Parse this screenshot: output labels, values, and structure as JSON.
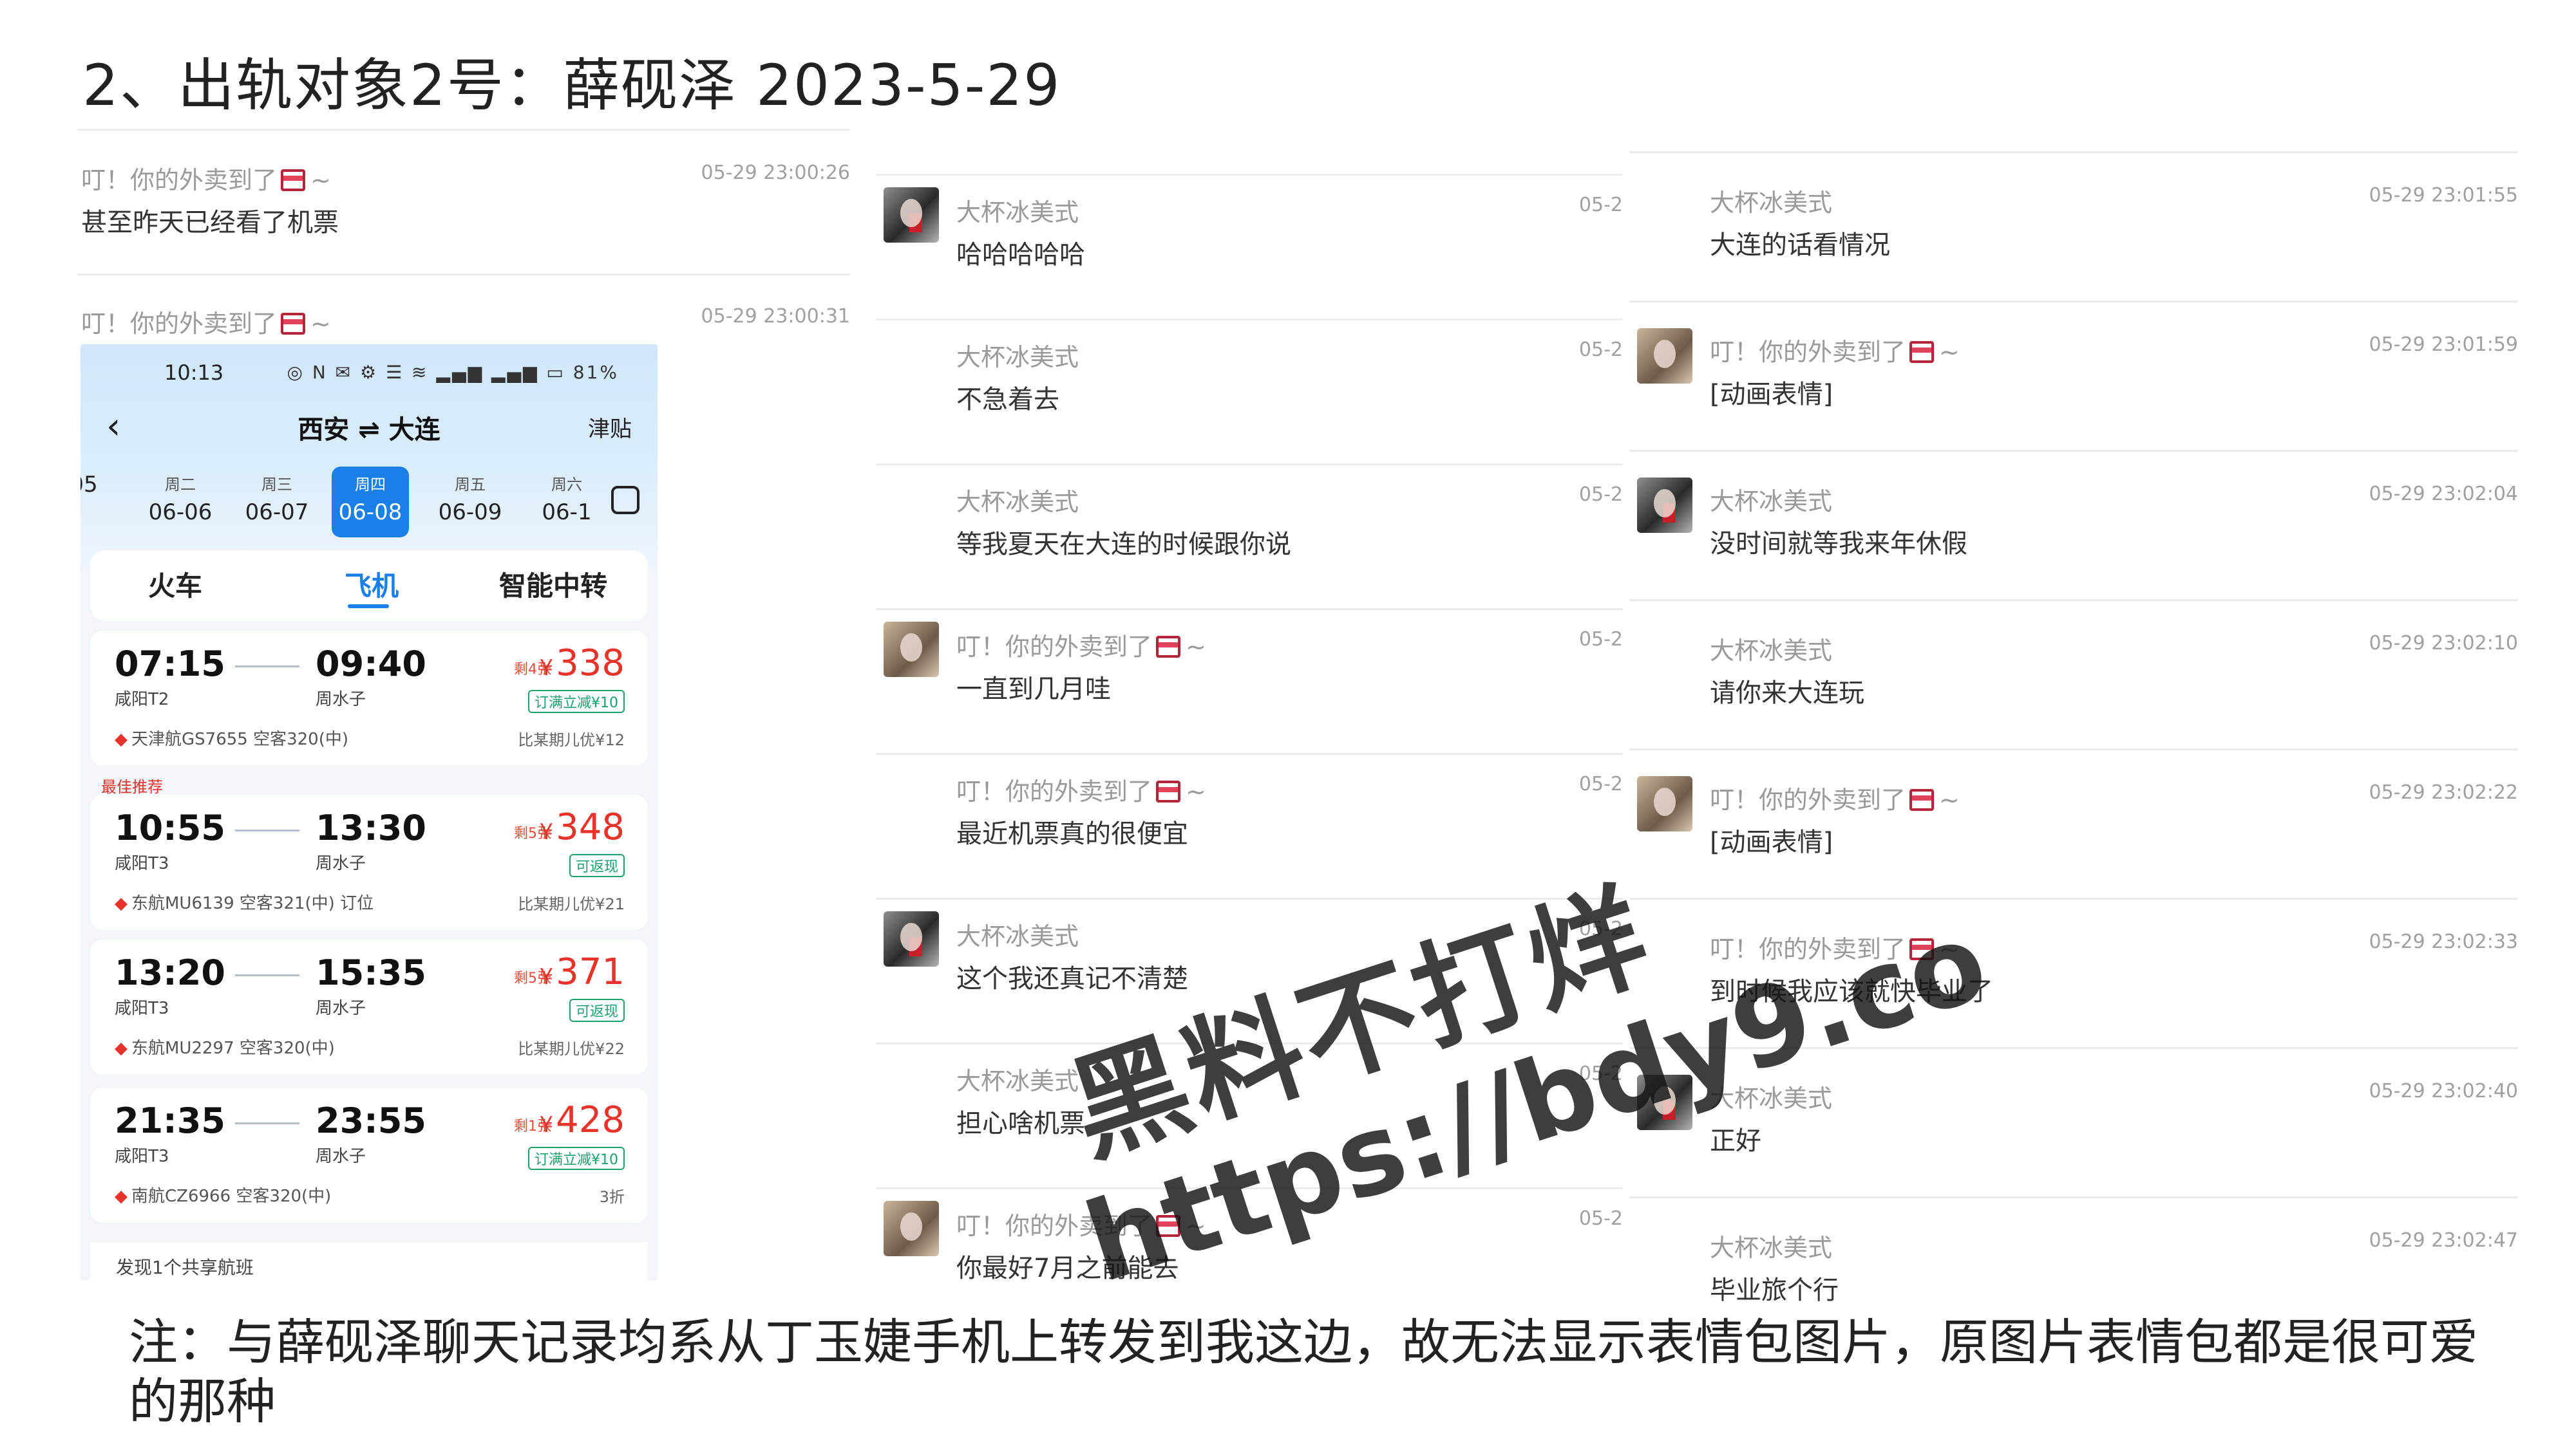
{
  "title": "2、出轨对象2号：薛砚泽  2023-5-29",
  "note": "注：与薛砚泽聊天记录均系从丁玉婕手机上转发到我这边，故无法显示表情包图片，原图片表情包都是很可爱的那种",
  "senders": {
    "takeaway": "叮！你的外卖到了",
    "iced": "大杯冰美式"
  },
  "left_chat": [
    {
      "sender": "叮！你的外卖到了",
      "time": "05-29 23:00:26",
      "text": "甚至昨天已经看了机票"
    },
    {
      "sender": "叮！你的外卖到了",
      "time": "05-29 23:00:31",
      "text": ""
    }
  ],
  "middle_chat": [
    {
      "sender": "大杯冰美式",
      "time": "05-2",
      "text": "哈哈哈哈哈"
    },
    {
      "sender": "大杯冰美式",
      "time": "05-2",
      "text": "不急着去"
    },
    {
      "sender": "大杯冰美式",
      "time": "05-2",
      "text": "等我夏天在大连的时候跟你说"
    },
    {
      "sender": "叮！你的外卖到了",
      "time": "05-2",
      "text": "一直到几月哇"
    },
    {
      "sender": "叮！你的外卖到了",
      "time": "05-2",
      "text": "最近机票真的很便宜"
    },
    {
      "sender": "大杯冰美式",
      "time": "05-2",
      "text": "这个我还真记不清楚"
    },
    {
      "sender": "大杯冰美式",
      "time": "05-2",
      "text": "担心啥机票"
    },
    {
      "sender": "叮！你的外卖到了",
      "time": "05-2",
      "text": "你最好7月之前能去"
    }
  ],
  "right_chat": [
    {
      "sender": "大杯冰美式",
      "time": "05-29 23:01:55",
      "text": "大连的话看情况"
    },
    {
      "sender": "叮！你的外卖到了",
      "time": "05-29 23:01:59",
      "text": "[动画表情]"
    },
    {
      "sender": "大杯冰美式",
      "time": "05-29 23:02:04",
      "text": "没时间就等我来年休假"
    },
    {
      "sender": "大杯冰美式",
      "time": "05-29 23:02:10",
      "text": "请你来大连玩"
    },
    {
      "sender": "叮！你的外卖到了",
      "time": "05-29 23:02:22",
      "text": "[动画表情]"
    },
    {
      "sender": "叮！你的外卖到了",
      "time": "05-29 23:02:33",
      "text": "到时候我应该就快毕业了"
    },
    {
      "sender": "大杯冰美式",
      "time": "05-29 23:02:40",
      "text": "正好"
    },
    {
      "sender": "大杯冰美式",
      "time": "05-29 23:02:47",
      "text": "毕业旅个行"
    }
  ],
  "phone": {
    "status_time": "10:13",
    "status_icons": "◎ N ✉ ⚙ ☰ ≋ ▂▄▆ ▂▄▆ ▭ 81%",
    "route": "西安 ⇌ 大连",
    "subsidy": "津贴",
    "dates": [
      {
        "weekday": "",
        "date": "05"
      },
      {
        "weekday": "周二",
        "date": "06-06"
      },
      {
        "weekday": "周三",
        "date": "06-07"
      },
      {
        "weekday": "周四",
        "date": "06-08"
      },
      {
        "weekday": "周五",
        "date": "06-09"
      },
      {
        "weekday": "周六",
        "date": "06-1"
      }
    ],
    "tabs": [
      "火车",
      "飞机",
      "智能中转"
    ],
    "best_tag": "最佳推荐",
    "flights": [
      {
        "dep": "07:15",
        "arr": "09:40",
        "dep_airport": "咸阳T2",
        "arr_airport": "周水子",
        "avail": "剩4张",
        "price": "338",
        "promo": "订满立减¥10",
        "airline": "天津航GS7655 空客320(中)",
        "fare": "比某期儿优¥12"
      },
      {
        "dep": "10:55",
        "arr": "13:30",
        "dep_airport": "咸阳T3",
        "arr_airport": "周水子",
        "avail": "剩5张",
        "price": "348",
        "promo": "可返现",
        "airline": "东航MU6139 空客321(中) 订位",
        "fare": "比某期儿优¥21"
      },
      {
        "dep": "13:20",
        "arr": "15:35",
        "dep_airport": "咸阳T3",
        "arr_airport": "周水子",
        "avail": "剩5张",
        "price": "371",
        "promo": "可返现",
        "airline": "东航MU2297 空客320(中)",
        "fare": "比某期儿优¥22"
      },
      {
        "dep": "21:35",
        "arr": "23:55",
        "dep_airport": "咸阳T3",
        "arr_airport": "周水子",
        "avail": "剩1张",
        "price": "428",
        "promo": "订满立减¥10",
        "airline": "南航CZ6966 空客320(中)",
        "fare": "3折"
      }
    ],
    "shared_flight": "发现1个共享航班"
  },
  "watermark": {
    "line1": "黑料不打烊",
    "line2": "https://bdy9.co"
  },
  "colors": {
    "accent_blue": "#1a7fe8",
    "price_red": "#e8332a",
    "promo_green": "#19a36b"
  }
}
